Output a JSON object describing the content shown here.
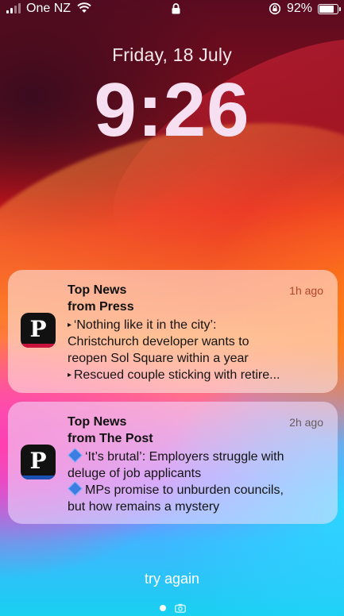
{
  "status_bar": {
    "carrier": "One NZ",
    "battery": "92%",
    "battery_level": 0.92,
    "icons": [
      "signal-icon",
      "wifi-icon",
      "lock-icon",
      "rotation-lock-icon",
      "battery-icon"
    ]
  },
  "lock_screen": {
    "date": "Friday, 18 July",
    "time": "9:26"
  },
  "notifications": [
    {
      "title_line1": "Top News",
      "title_line2": "from Press",
      "time": "1h ago",
      "icon_letter": "P",
      "lines": [
        "‘Nothing like it in the city’:",
        "Christchurch developer wants to",
        "reopen Sol Square within a year",
        "Rescued couple sticking with retire..."
      ],
      "accent": "#c8143c"
    },
    {
      "title_line1": "Top News",
      "title_line2": "from The Post",
      "time": "2h ago",
      "icon_letter": "P",
      "lines": [
        "‘It’s brutal’: Employers struggle with",
        "deluge of job applicants",
        "MPs promise to unburden councils,",
        "but how remains a mystery"
      ],
      "accent": "#1a4fb4"
    }
  ],
  "footer": {
    "action": "try again",
    "icons": [
      "page-dot-icon",
      "camera-icon"
    ]
  }
}
